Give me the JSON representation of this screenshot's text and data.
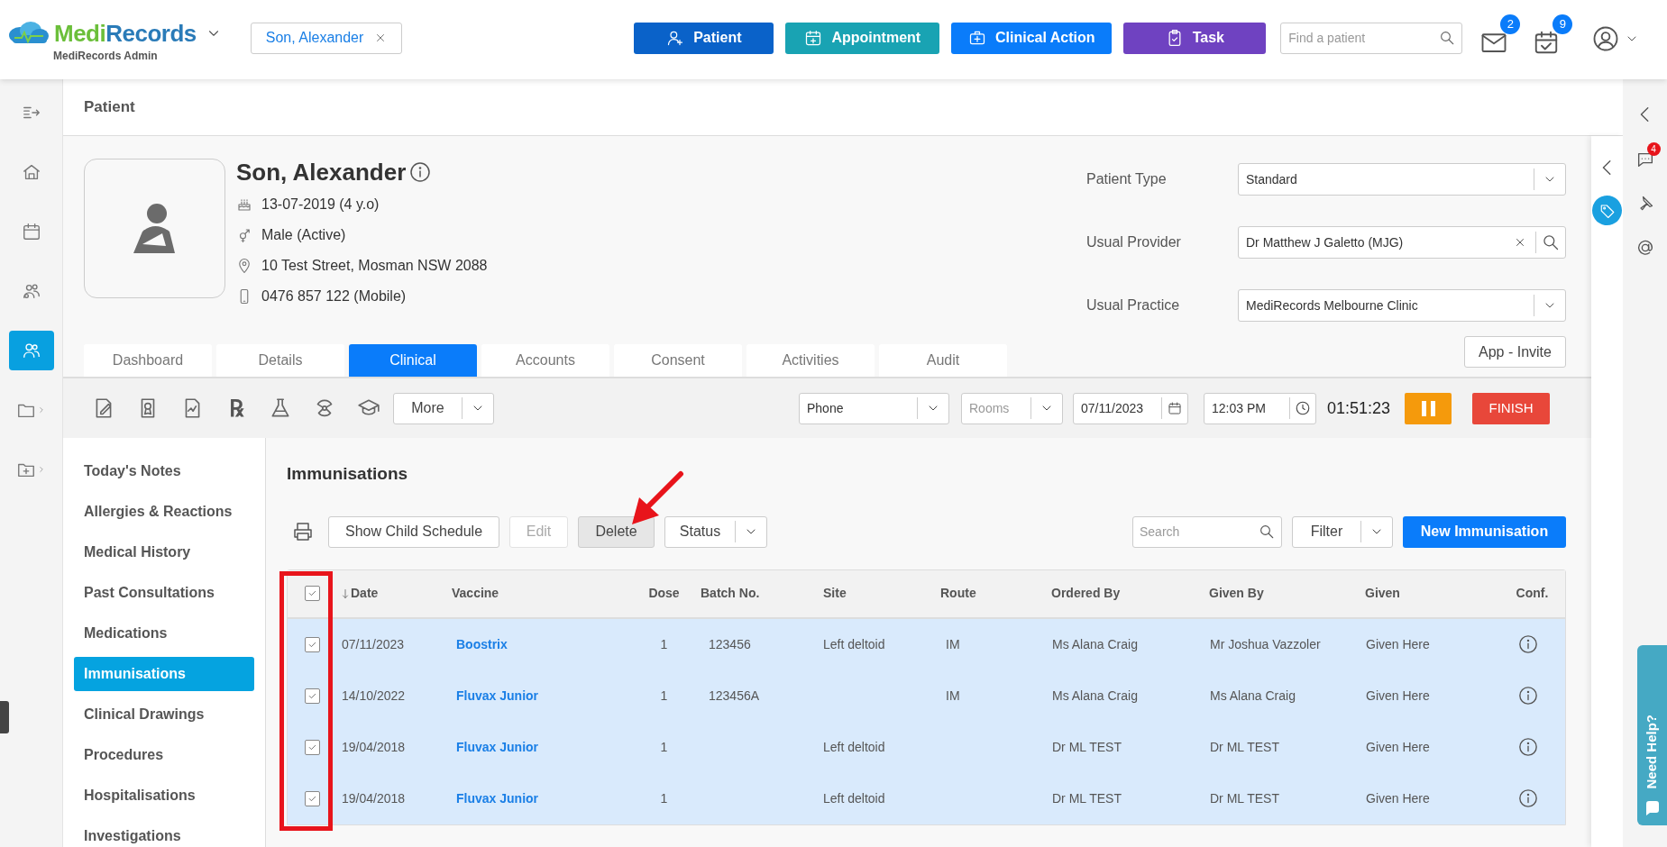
{
  "app": {
    "brand_first": "Medi",
    "brand_second": "Records",
    "subtitle": "MediRecords Admin"
  },
  "open_patient_tab": {
    "label": "Son, Alexander"
  },
  "action_buttons": [
    {
      "label": "Patient",
      "kind": "patient",
      "color": "#0a62c9"
    },
    {
      "label": "Appointment",
      "kind": "appointment",
      "color": "#19a3b3"
    },
    {
      "label": "Clinical Action",
      "kind": "clinical",
      "color": "#0a7cfa"
    },
    {
      "label": "Task",
      "kind": "task",
      "color": "#6f42c1"
    }
  ],
  "patient_search": {
    "placeholder": "Find a patient"
  },
  "notifications": [
    {
      "kind": "mail",
      "count": "2"
    },
    {
      "kind": "calendar",
      "count": "9"
    }
  ],
  "left_rail": [
    {
      "kind": "collapse",
      "selected": false
    },
    {
      "kind": "home",
      "selected": false
    },
    {
      "kind": "calendar",
      "selected": false
    },
    {
      "kind": "groups",
      "selected": false
    },
    {
      "kind": "patients",
      "selected": true
    },
    {
      "kind": "folder",
      "selected": false
    },
    {
      "kind": "folder-add",
      "selected": false
    }
  ],
  "page_title": "Patient",
  "patient": {
    "name": "Son, Alexander",
    "details": [
      {
        "kind": "dob",
        "text": "13-07-2019 (4 y.o)"
      },
      {
        "kind": "gender",
        "text": "Male (Active)"
      },
      {
        "kind": "address",
        "text": "10 Test Street, Mosman NSW 2088"
      },
      {
        "kind": "phone",
        "text": "0476 857 122 (Mobile)"
      }
    ]
  },
  "patient_fields": [
    {
      "label": "Patient Type",
      "value": "Standard",
      "kind": "select"
    },
    {
      "label": "Usual Provider",
      "value": "Dr Matthew J Galetto (MJG)",
      "kind": "lookup"
    },
    {
      "label": "Usual Practice",
      "value": "MediRecords Melbourne Clinic",
      "kind": "select"
    }
  ],
  "app_invite_button": "App - Invite",
  "tabs": [
    {
      "label": "Dashboard",
      "selected": false
    },
    {
      "label": "Details",
      "selected": false
    },
    {
      "label": "Clinical",
      "selected": true
    },
    {
      "label": "Accounts",
      "selected": false
    },
    {
      "label": "Consent",
      "selected": false
    },
    {
      "label": "Activities",
      "selected": false
    },
    {
      "label": "Audit",
      "selected": false
    }
  ],
  "toolbar": {
    "tools": [
      {
        "kind": "note"
      },
      {
        "kind": "certificate"
      },
      {
        "kind": "chart"
      },
      {
        "kind": "rx",
        "glyph": "℞"
      },
      {
        "kind": "lab"
      },
      {
        "kind": "radiation"
      },
      {
        "kind": "education"
      }
    ],
    "more_button": "More",
    "encounter_type": "Phone",
    "rooms_placeholder": "Rooms",
    "date": "07/11/2023",
    "time": "12:03 PM",
    "timer": "01:51:23",
    "finish_button": "FINISH"
  },
  "clinical_nav": [
    {
      "label": "Today's Notes",
      "selected": false
    },
    {
      "label": "Allergies & Reactions",
      "selected": false
    },
    {
      "label": "Medical History",
      "selected": false
    },
    {
      "label": "Past Consultations",
      "selected": false
    },
    {
      "label": "Medications",
      "selected": false
    },
    {
      "label": "Immunisations",
      "selected": true
    },
    {
      "label": "Clinical Drawings",
      "selected": false
    },
    {
      "label": "Procedures",
      "selected": false
    },
    {
      "label": "Hospitalisations",
      "selected": false
    },
    {
      "label": "Investigations",
      "selected": false
    }
  ],
  "section_title": "Immunisations",
  "actions": [
    {
      "label": "Show Child Schedule",
      "disabled": false,
      "highlighted": false
    },
    {
      "label": "Edit",
      "disabled": true,
      "highlighted": false
    },
    {
      "label": "Delete",
      "disabled": false,
      "highlighted": true
    }
  ],
  "status_dropdown": "Status",
  "table_search": {
    "placeholder": "Search"
  },
  "filter_dropdown": "Filter",
  "new_button": "New Immunisation",
  "table": {
    "all_checked": true,
    "columns": [
      "Date",
      "Vaccine",
      "Dose",
      "Batch No.",
      "Site",
      "Route",
      "Ordered By",
      "Given By",
      "Given",
      "Conf."
    ],
    "rows": [
      {
        "checked": true,
        "cells": [
          "07/11/2023",
          "Boostrix",
          "1",
          "123456",
          "Left deltoid",
          "IM",
          "Ms Alana Craig",
          "Mr Joshua Vazzoler",
          "Given Here"
        ]
      },
      {
        "checked": true,
        "cells": [
          "14/10/2022",
          "Fluvax Junior",
          "1",
          "123456A",
          "",
          "IM",
          "Ms Alana Craig",
          "Ms Alana Craig",
          "Given Here"
        ]
      },
      {
        "checked": true,
        "cells": [
          "19/04/2018",
          "Fluvax Junior",
          "1",
          "",
          "Left deltoid",
          "",
          "Dr ML TEST",
          "Dr ML TEST",
          "Given Here"
        ]
      },
      {
        "checked": true,
        "cells": [
          "19/04/2018",
          "Fluvax Junior",
          "1",
          "",
          "Left deltoid",
          "",
          "Dr ML TEST",
          "Dr ML TEST",
          "Given Here"
        ]
      }
    ]
  },
  "annotations": {
    "checkbox_highlight": true,
    "delete_arrow": true
  },
  "right_rail": {
    "chat_count": "4"
  },
  "help_tab": "Need Help?"
}
